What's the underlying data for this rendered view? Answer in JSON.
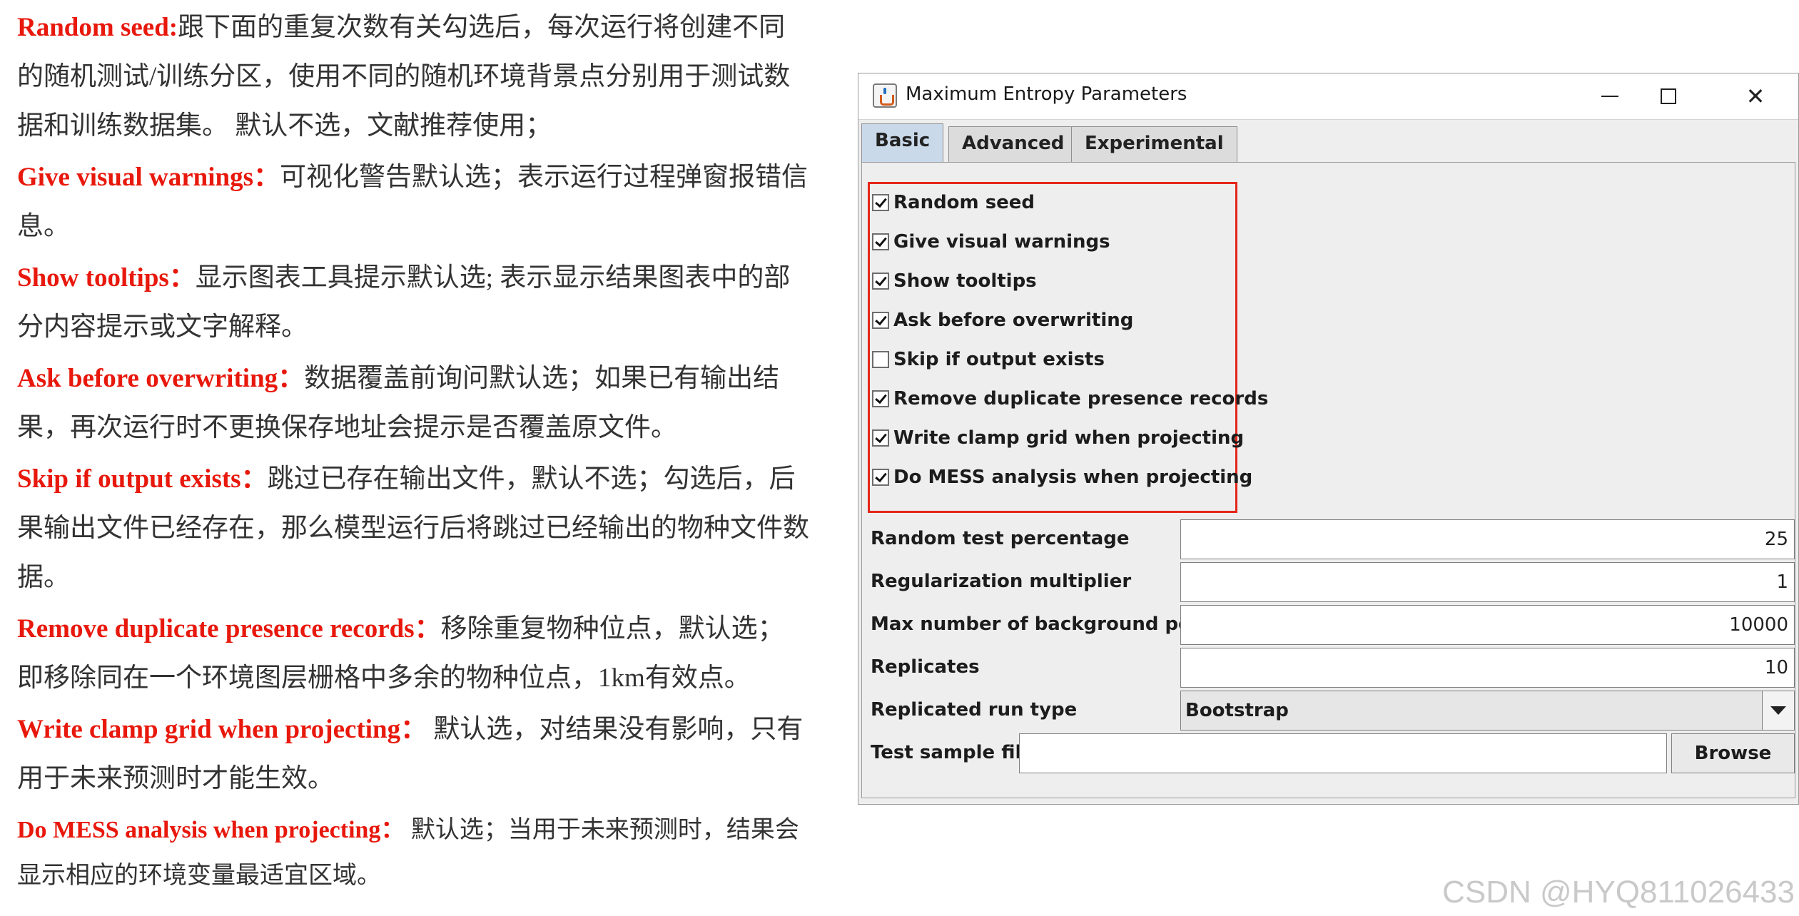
{
  "doc": {
    "entries": [
      {
        "term": "Random seed:",
        "text": "跟下面的重复次数有关勾选后，每次运行将创建不同的随机测试/训练分区，使用不同的随机环境背景点分别用于测试数据和训练数据集。 默认不选，文献推荐使用；"
      },
      {
        "term": "Give visual warnings：",
        "text": "可视化警告默认选；表示运行过程弹窗报错信息。"
      },
      {
        "term": "Show tooltips：",
        "text": "显示图表工具提示默认选; 表示显示结果图表中的部分内容提示或文字解释。"
      },
      {
        "term": "Ask before overwriting：",
        "text": "数据覆盖前询问默认选；如果已有输出结果，再次运行时不更换保存地址会提示是否覆盖原文件。"
      },
      {
        "term": "Skip if output exists：",
        "text": "跳过已存在输出文件，默认不选；勾选后，后果输出文件已经存在，那么模型运行后将跳过已经输出的物种文件数据。"
      },
      {
        "term": "Remove duplicate presence records：",
        "text": "移除重复物种位点，默认选；即移除同在一个环境图层栅格中多余的物种位点，1km有效点。"
      },
      {
        "term": "Write clamp grid when projecting：",
        "text": " 默认选，对结果没有影响，只有用于未来预测时才能生效。"
      },
      {
        "term": "Do MESS analysis when projecting：",
        "text": " 默认选；当用于未来预测时，结果会显示相应的环境变量最适宜区域。"
      }
    ]
  },
  "dialog": {
    "title": "Maximum Entropy Parameters",
    "window_controls": {
      "minimize": "—",
      "maximize": "☐",
      "close": "✕"
    },
    "tabs": [
      {
        "label": "Basic",
        "active": true
      },
      {
        "label": "Advanced",
        "active": false
      },
      {
        "label": "Experimental",
        "active": false
      }
    ],
    "options": [
      {
        "label": "Random seed",
        "checked": true
      },
      {
        "label": "Give visual warnings",
        "checked": true
      },
      {
        "label": "Show tooltips",
        "checked": true
      },
      {
        "label": "Ask before overwriting",
        "checked": true
      },
      {
        "label": "Skip if output exists",
        "checked": false
      },
      {
        "label": "Remove duplicate presence records",
        "checked": true
      },
      {
        "label": "Write clamp grid when projecting",
        "checked": true
      },
      {
        "label": "Do MESS analysis when projecting",
        "checked": true
      }
    ],
    "fields": {
      "random_test_percentage": {
        "label": "Random test percentage",
        "value": "25"
      },
      "regularization_multiplier": {
        "label": "Regularization multiplier",
        "value": "1"
      },
      "max_background_points": {
        "label": "Max number of background points",
        "value": "10000"
      },
      "replicates": {
        "label": "Replicates",
        "value": "10"
      },
      "replicated_run_type": {
        "label": "Replicated run type",
        "value": "Bootstrap"
      },
      "test_sample_file": {
        "label": "Test sample file",
        "value": "",
        "button": "Browse"
      }
    }
  },
  "watermark": "CSDN @HYQ811026433",
  "colors": {
    "term": "#e8180c",
    "highlight_box": "#e5261a",
    "active_tab": "#c9d9ea"
  }
}
